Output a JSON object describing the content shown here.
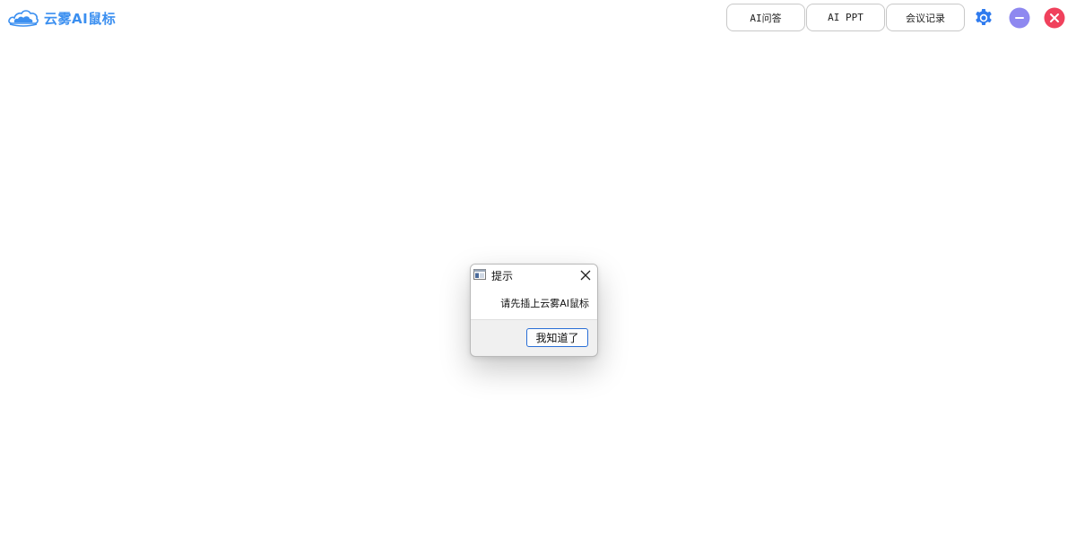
{
  "app": {
    "title": "云雾AI鼠标",
    "brand_color": "#3b8ff0"
  },
  "toolbar": {
    "buttons": [
      {
        "label": "AI问答"
      },
      {
        "label": "AI PPT"
      },
      {
        "label": "会议记录"
      }
    ],
    "icons": {
      "settings": {
        "name": "gear-icon",
        "color": "#2f7bef"
      },
      "minimize": {
        "name": "minimize-icon",
        "color": "#8e88f0"
      },
      "close": {
        "name": "close-icon",
        "color": "#f0415c"
      }
    }
  },
  "dialog": {
    "title": "提示",
    "message": "请先插上云雾AI鼠标",
    "ok_label": "我知道了",
    "accent_color": "#2a6fd6"
  }
}
